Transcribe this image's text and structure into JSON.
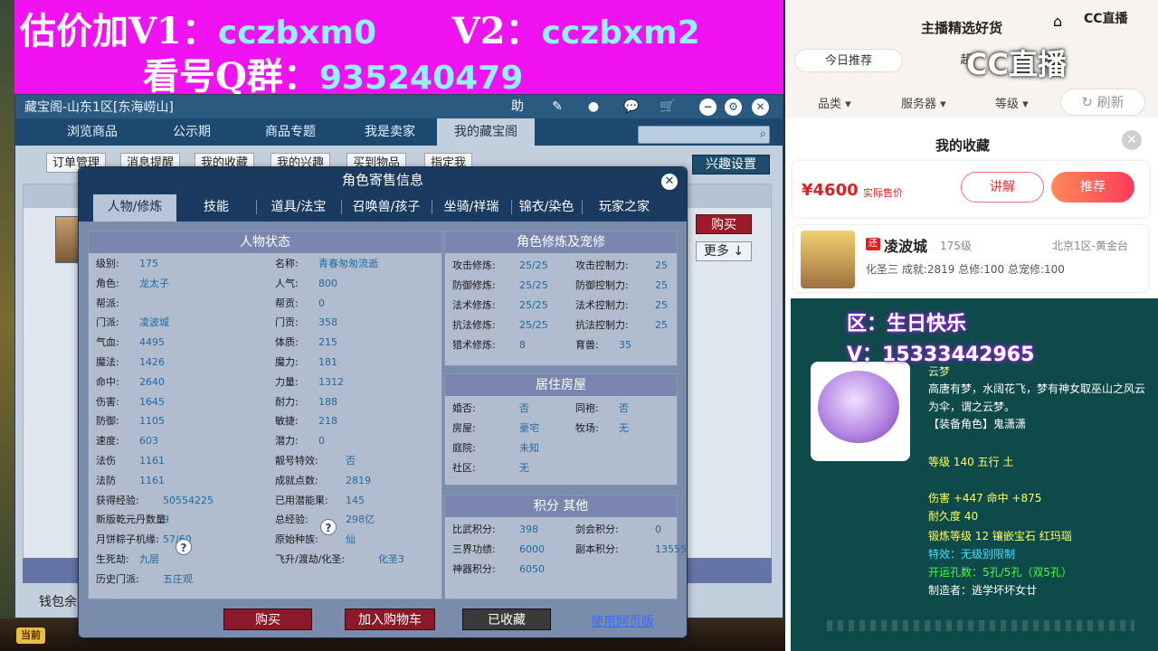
{
  "banner": {
    "line1_a": "估价加V1：",
    "line1_b": "cczbxm0",
    "line1_c": "V2：",
    "line1_d": "cczbxm2",
    "line2_a": "看号Q群：",
    "line2_b": "935240479"
  },
  "cbg": {
    "title": "藏宝阁-山东1区[东海崂山]",
    "help": "助",
    "tabs": [
      "浏览商品",
      "公示期",
      "商品专题",
      "我是卖家",
      "我的藏宝阁"
    ],
    "subtabs": [
      "订单管理",
      "消息提醒",
      "我的收藏",
      "我的兴趣",
      "买到物品",
      "指定我"
    ],
    "interest_settings": "兴趣设置",
    "buy": "购买",
    "more": "更多",
    "wallet": "钱包余",
    "current": "当前"
  },
  "modal": {
    "title": "角色寄售信息",
    "tabs": [
      "人物/修炼",
      "技能",
      "道具/法宝",
      "召唤兽/孩子",
      "坐骑/祥瑞",
      "锦衣/染色",
      "玩家之家"
    ],
    "status_header": "人物状态",
    "status_left": [
      {
        "label": "级别:",
        "value": "175"
      },
      {
        "label": "角色:",
        "value": "龙太子"
      },
      {
        "label": "帮派:",
        "value": ""
      },
      {
        "label": "门派:",
        "value": "凌波城"
      },
      {
        "label": "气血:",
        "value": "4495"
      },
      {
        "label": "魔法:",
        "value": "1426"
      },
      {
        "label": "命中:",
        "value": "2640"
      },
      {
        "label": "伤害:",
        "value": "1645"
      },
      {
        "label": "防御:",
        "value": "1105"
      },
      {
        "label": "速度:",
        "value": "603"
      },
      {
        "label": "法伤",
        "value": "1161"
      },
      {
        "label": "法防",
        "value": "1161"
      },
      {
        "label": "获得经验:",
        "value": "50554225"
      },
      {
        "label": "新版乾元丹数量",
        "value": "9"
      },
      {
        "label": "月饼粽子机缘:",
        "value": "57/60"
      },
      {
        "label": "生死劫:",
        "value": "九层"
      },
      {
        "label": "历史门派:",
        "value": "五庄观"
      }
    ],
    "status_right": [
      {
        "label": "名称:",
        "value": "青春匆匆流逝"
      },
      {
        "label": "人气:",
        "value": "800"
      },
      {
        "label": "帮贡:",
        "value": "0"
      },
      {
        "label": "门贡:",
        "value": "358"
      },
      {
        "label": "体质:",
        "value": "215"
      },
      {
        "label": "魔力:",
        "value": "181"
      },
      {
        "label": "力量:",
        "value": "1312"
      },
      {
        "label": "耐力:",
        "value": "188"
      },
      {
        "label": "敏捷:",
        "value": "218"
      },
      {
        "label": "潜力:",
        "value": "0"
      },
      {
        "label": "靓号特效:",
        "value": "否"
      },
      {
        "label": "成就点数:",
        "value": "2819"
      },
      {
        "label": "已用潜能果:",
        "value": "145"
      },
      {
        "label": "总经验:",
        "value": "298亿"
      },
      {
        "label": "原始种族:",
        "value": "仙"
      },
      {
        "label": "飞升/渡劫/化圣:",
        "value": "化圣3"
      }
    ],
    "cultivation_header": "角色修炼及宠修",
    "cultivation": [
      {
        "l1": "攻击修炼:",
        "v1": "25/25",
        "l2": "攻击控制力:",
        "v2": "25"
      },
      {
        "l1": "防御修炼:",
        "v1": "25/25",
        "l2": "防御控制力:",
        "v2": "25"
      },
      {
        "l1": "法术修炼:",
        "v1": "25/25",
        "l2": "法术控制力:",
        "v2": "25"
      },
      {
        "l1": "抗法修炼:",
        "v1": "25/25",
        "l2": "抗法控制力:",
        "v2": "25"
      },
      {
        "l1": "猎术修炼:",
        "v1": "8",
        "l2": "育兽:",
        "v2": "35"
      }
    ],
    "house_header": "居住房屋",
    "house": [
      {
        "l1": "婚否:",
        "v1": "否",
        "l2": "同袍:",
        "v2": "否"
      },
      {
        "l1": "房屋:",
        "v1": "豪宅",
        "l2": "牧场:",
        "v2": "无"
      },
      {
        "l1": "庭院:",
        "v1": "未知",
        "l2": "",
        "v2": ""
      },
      {
        "l1": "社区:",
        "v1": "无",
        "l2": "",
        "v2": ""
      }
    ],
    "points_header": "积分 其他",
    "points": [
      {
        "l1": "比武积分:",
        "v1": "398",
        "l2": "剑会积分:",
        "v2": "0"
      },
      {
        "l1": "三界功绩:",
        "v1": "6000",
        "l2": "副本积分:",
        "v2": "13555"
      },
      {
        "l1": "神器积分:",
        "v1": "6050",
        "l2": "",
        "v2": ""
      }
    ],
    "question": "?",
    "btn_buy": "购买",
    "btn_cart": "加入购物车",
    "btn_fav": "已收藏",
    "web_link": "使用网页版"
  },
  "shop": {
    "title": "主播精选好货",
    "cc_small": "CC直播",
    "cc_logo": "CC直播",
    "tab_today": "今日推荐",
    "tab_other": "超",
    "filters": [
      "品类",
      "服务器",
      "等级"
    ],
    "refresh": "刷新"
  },
  "favorites": {
    "title": "我的收藏",
    "price": "¥4600",
    "price_note": "实际售价",
    "explain": "讲解",
    "recommend": "推荐",
    "item_badge": "还",
    "item_name": "凌波城",
    "item_level": "175级",
    "item_server": "北京1区-黄金台",
    "item_stats": "化圣三 成就:2819 总修:100 总宠修:100"
  },
  "tooltip": {
    "area": "区：生日快乐",
    "v": "V：15333442965",
    "name": "云梦",
    "desc": "高唐有梦，水阔花飞，梦有神女取巫山之风云为伞，谓之云梦。",
    "role": "【装备角色】鬼潇潇",
    "level": "等级 140 五行 土",
    "attack": "伤害 +447 命中 +875",
    "durability": "耐久度 40",
    "forge": "锻炼等级 12 镶嵌宝石 红玛瑙",
    "effect": "特效：无级别限制",
    "holes": "开运孔数：5孔/5孔（双5孔）",
    "maker": "制造者：逃学坏坏女廿"
  },
  "colors": {
    "banner": "#f012f0",
    "banner_text_cyan": "#8ff3ff",
    "buy_red": "#8a1a2a",
    "value_blue": "#1d6aa0",
    "tooltip_bg": "#0f4a4a"
  }
}
